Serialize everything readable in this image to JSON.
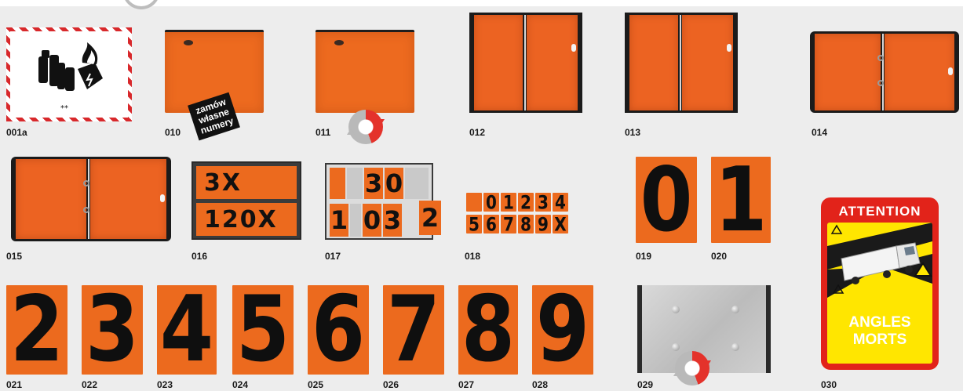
{
  "colors": {
    "plate_orange": "#ec6a1e",
    "frame_black": "#1b1b1b",
    "hazard_red": "#d8282b",
    "sticker_red": "#e2231a",
    "sticker_yellow": "#ffe600",
    "rotate_red": "#e4322b",
    "rotate_grey": "#b9b9b9"
  },
  "stamp": {
    "line1": "zamów",
    "line2": "własne",
    "line3": "numery"
  },
  "items": {
    "001a": {
      "code": "001a",
      "icon": "lithium-battery-hazard-icon",
      "mark": "⁎⁎"
    },
    "010": {
      "code": "010"
    },
    "011": {
      "code": "011",
      "icon": "rotate-icon"
    },
    "012": {
      "code": "012"
    },
    "013": {
      "code": "013"
    },
    "014": {
      "code": "014"
    },
    "015": {
      "code": "015"
    },
    "016": {
      "code": "016",
      "top_number": "3X",
      "bottom_number": "120X"
    },
    "017": {
      "code": "017",
      "top_digits": [
        "3",
        "0"
      ],
      "bottom_digits": [
        "1",
        "0",
        "3",
        "2"
      ]
    },
    "018": {
      "code": "018",
      "row1": [
        "0",
        "1",
        "2",
        "3",
        "4"
      ],
      "row2": [
        "5",
        "6",
        "7",
        "8",
        "9",
        "X"
      ]
    },
    "019": {
      "code": "019",
      "digit": "0"
    },
    "020": {
      "code": "020",
      "digit": "1"
    },
    "021": {
      "code": "021",
      "digit": "2"
    },
    "022": {
      "code": "022",
      "digit": "3"
    },
    "023": {
      "code": "023",
      "digit": "4"
    },
    "024": {
      "code": "024",
      "digit": "5"
    },
    "025": {
      "code": "025",
      "digit": "6"
    },
    "026": {
      "code": "026",
      "digit": "7"
    },
    "027": {
      "code": "027",
      "digit": "8"
    },
    "028": {
      "code": "028",
      "digit": "9"
    },
    "029": {
      "code": "029",
      "icon": "rotate-icon"
    },
    "030": {
      "code": "030",
      "title": "ATTENTION",
      "line1": "ANGLES",
      "line2": "MORTS",
      "icon": "truck-blind-spot-icon"
    }
  }
}
